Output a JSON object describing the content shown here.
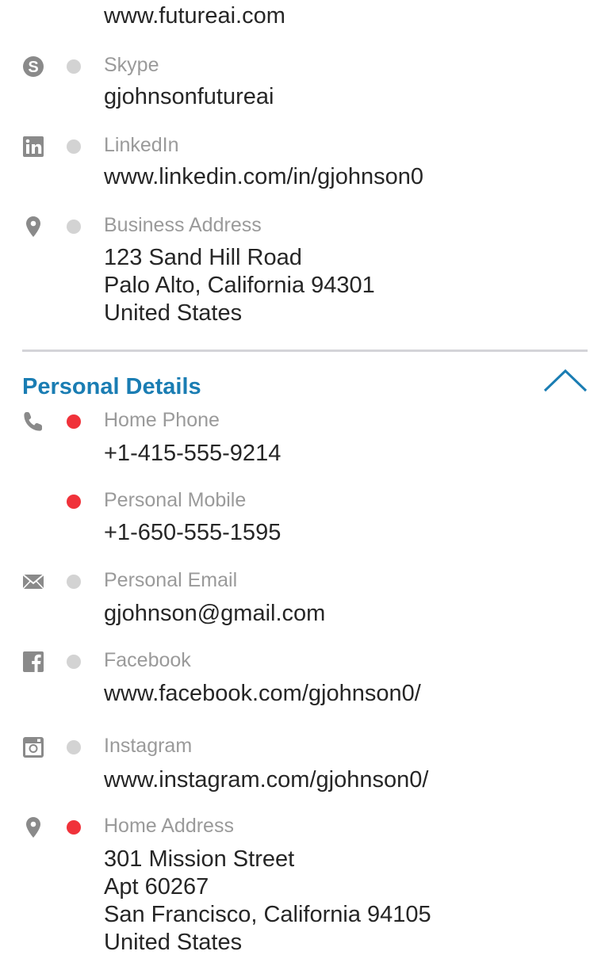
{
  "work_details": {
    "website_value": "www.futureai.com",
    "skype": {
      "icon": "skype-icon",
      "label": "Skype",
      "value": "gjohnsonfutureai",
      "dot_color": "#d3d3d3"
    },
    "linkedin": {
      "icon": "linkedin-icon",
      "label": "LinkedIn",
      "value": "www.linkedin.com/in/gjohnson0",
      "dot_color": "#d3d3d3"
    },
    "business_address": {
      "icon": "location-pin-icon",
      "label": "Business Address",
      "lines": [
        "123 Sand Hill Road",
        "Palo Alto, California 94301",
        "United States"
      ],
      "dot_color": "#d3d3d3"
    }
  },
  "personal_details": {
    "title": "Personal Details",
    "accent_color": "#1a7db3",
    "collapse_icon": "chevron-up-icon",
    "home_phone": {
      "icon": "phone-icon",
      "label": "Home Phone",
      "value": "+1-415-555-9214",
      "dot_color": "#f0323a"
    },
    "personal_mobile": {
      "label": "Personal Mobile",
      "value": "+1-650-555-1595",
      "dot_color": "#f0323a"
    },
    "personal_email": {
      "icon": "envelope-icon",
      "label": "Personal Email",
      "value": "gjohnson@gmail.com",
      "dot_color": "#d3d3d3"
    },
    "facebook": {
      "icon": "facebook-icon",
      "label": "Facebook",
      "value": "www.facebook.com/gjohnson0/",
      "dot_color": "#d3d3d3"
    },
    "instagram": {
      "icon": "instagram-icon",
      "label": "Instagram",
      "value": "www.instagram.com/gjohnson0/",
      "dot_color": "#d3d3d3"
    },
    "home_address": {
      "icon": "location-pin-icon",
      "label": "Home Address",
      "lines": [
        "301 Mission Street",
        "Apt 60267",
        "San Francisco, California 94105",
        "United States"
      ],
      "dot_color": "#f0323a"
    }
  }
}
